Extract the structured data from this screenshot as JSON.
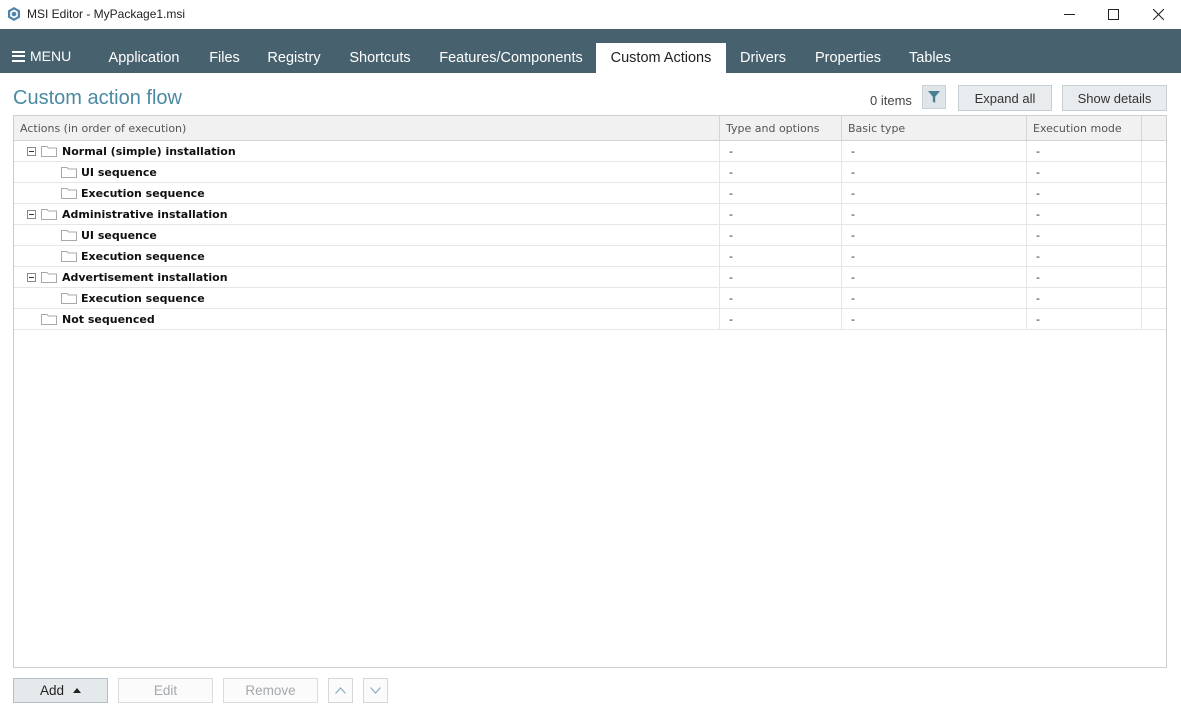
{
  "window": {
    "title": "MSI Editor - MyPackage1.msi",
    "icon": "app-hexagon-icon"
  },
  "menu": {
    "menu_label": "MENU",
    "tabs": [
      {
        "label": "Application"
      },
      {
        "label": "Files"
      },
      {
        "label": "Registry"
      },
      {
        "label": "Shortcuts"
      },
      {
        "label": "Features/Components"
      },
      {
        "label": "Custom Actions",
        "active": true
      },
      {
        "label": "Drivers"
      },
      {
        "label": "Properties"
      },
      {
        "label": "Tables"
      }
    ]
  },
  "header": {
    "title": "Custom action flow",
    "items_count": "0 items",
    "expand_all_label": "Expand all",
    "show_details_label": "Show details"
  },
  "grid": {
    "columns": [
      "Actions (in order of execution)",
      "Type and options",
      "Basic type",
      "Execution mode"
    ],
    "rows": [
      {
        "name": "Normal (simple) installation",
        "type": "-",
        "basic": "-",
        "mode": "-",
        "level": 0,
        "expanded": true
      },
      {
        "name": "UI sequence",
        "type": "-",
        "basic": "-",
        "mode": "-",
        "level": 1
      },
      {
        "name": "Execution sequence",
        "type": "-",
        "basic": "-",
        "mode": "-",
        "level": 1
      },
      {
        "name": "Administrative installation",
        "type": "-",
        "basic": "-",
        "mode": "-",
        "level": 0,
        "expanded": true
      },
      {
        "name": "UI sequence",
        "type": "-",
        "basic": "-",
        "mode": "-",
        "level": 1
      },
      {
        "name": "Execution sequence",
        "type": "-",
        "basic": "-",
        "mode": "-",
        "level": 1
      },
      {
        "name": "Advertisement installation",
        "type": "-",
        "basic": "-",
        "mode": "-",
        "level": 0,
        "expanded": true
      },
      {
        "name": "Execution sequence",
        "type": "-",
        "basic": "-",
        "mode": "-",
        "level": 1
      },
      {
        "name": "Not sequenced",
        "type": "-",
        "basic": "-",
        "mode": "-",
        "level": 0
      }
    ]
  },
  "footer": {
    "add_label": "Add",
    "edit_label": "Edit",
    "remove_label": "Remove"
  },
  "colors": {
    "menubar": "#47626e",
    "title_accent": "#4b8aa3"
  }
}
